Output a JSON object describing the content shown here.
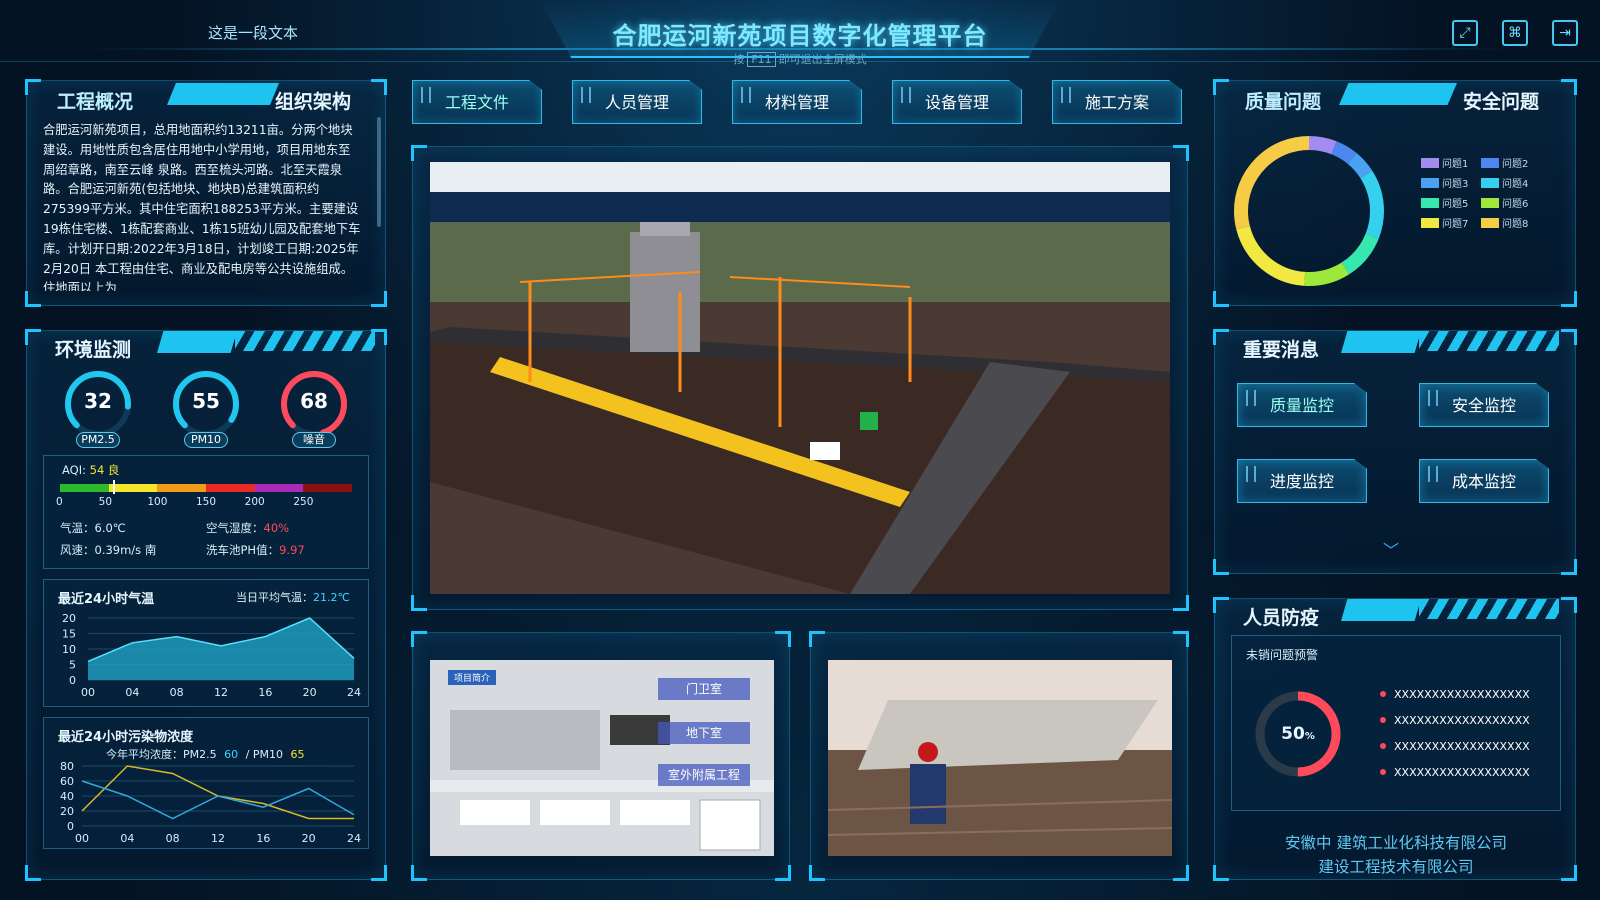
{
  "header": {
    "top_left_text": "这是一段文本",
    "title": "合肥运河新苑项目数字化管理平台",
    "fullscreen_hint_prefix": "按",
    "fullscreen_hint_key": "F11",
    "fullscreen_hint_suffix": "即可退出全屏模式",
    "icons": [
      "fullscreen-icon",
      "apps-icon",
      "logout-icon"
    ]
  },
  "overview": {
    "tab_active": "工程概况",
    "tab_other": "组织架构",
    "text": "合肥运河新苑项目，总用地面积约13211亩。分两个地块建设。用地性质包含居住用地中小学用地，项目用地东至周绍章路，南至云峰 泉路。西至梳头河路。北至天霞泉路。合肥运河新苑(包括地块、地块B)总建筑面积约275399平方米。其中住宅面积188253平方米。主要建设 19栋住宅楼、1栋配套商业、1栋15班幼儿园及配套地下车库。计划开日期:2022年3月18日，计划竣工日期:2025年2月20日 本工程由住宅、商业及配电房等公共设施组成。住地面以上为"
  },
  "environment": {
    "title": "环境监测",
    "gauges": [
      {
        "label": "PM2.5",
        "value": "32",
        "color": "#20c8f0",
        "fraction": 0.35
      },
      {
        "label": "PM10",
        "value": "55",
        "color": "#20c8f0",
        "fraction": 0.45
      },
      {
        "label": "噪音",
        "value": "68",
        "color": "#ff4a5b",
        "fraction": 0.6
      }
    ],
    "aqi_label": "AQI:",
    "aqi_value": "54 良",
    "aqi_fraction": 0.18,
    "aqi_ticks": [
      "0",
      "50",
      "100",
      "150",
      "200",
      "250"
    ],
    "aqi_colors": [
      "#2dbb2d",
      "#f4e52a",
      "#f39b19",
      "#ea2b25",
      "#a72ab8",
      "#8c1212"
    ],
    "temp_label": "气温：",
    "temp_value": "6.0℃",
    "humidity_label": "空气湿度：",
    "humidity_value": "40%",
    "wind_label": "风速：",
    "wind_value": "0.39m/s 南",
    "ph_label": "洗车池PH值：",
    "ph_value": "9.97"
  },
  "temp_chart": {
    "title": "最近24小时气温",
    "avg_label": "当日平均气温：",
    "avg_value": "21.2℃"
  },
  "pollution_chart": {
    "title": "最近24小时污染物浓度",
    "avg_label": "今年平均浓度：PM2.5",
    "pm25_value": "60",
    "sep": "/ PM10",
    "pm10_value": "65"
  },
  "chart_data": [
    {
      "type": "area",
      "title": "最近24小时气温",
      "x": [
        "00",
        "04",
        "08",
        "12",
        "16",
        "20",
        "24"
      ],
      "values": [
        6,
        12,
        14,
        11,
        14,
        20,
        7
      ],
      "ylim": [
        0,
        20
      ],
      "yticks": [
        "0",
        "5",
        "10",
        "15",
        "20"
      ],
      "color": "#1e9bbd"
    },
    {
      "type": "line",
      "title": "最近24小时污染物浓度",
      "x": [
        "00",
        "04",
        "08",
        "12",
        "16",
        "20",
        "24"
      ],
      "yticks": [
        "0",
        "20",
        "40",
        "60",
        "80"
      ],
      "ylim": [
        0,
        80
      ],
      "series": [
        {
          "values": [
            20,
            80,
            70,
            40,
            30,
            10,
            10
          ],
          "color": "#d9b92a"
        },
        {
          "values": [
            60,
            40,
            10,
            40,
            25,
            50,
            15
          ],
          "color": "#2fa9d8"
        }
      ]
    },
    {
      "type": "pie",
      "title": "质量问题",
      "categories": [
        "问题1",
        "问题2",
        "问题3",
        "问题4",
        "问题5",
        "问题6",
        "问题7",
        "问题8"
      ],
      "values": [
        6,
        5,
        5,
        15,
        10,
        10,
        20,
        29
      ],
      "colors": [
        "#a28cf0",
        "#4d86ef",
        "#4aa3f2",
        "#36d0ef",
        "#37e8ae",
        "#9ee83b",
        "#f1e942",
        "#f6cb45"
      ]
    }
  ],
  "tabs": [
    {
      "label": "工程文件"
    },
    {
      "label": "人员管理"
    },
    {
      "label": "材料管理"
    },
    {
      "label": "设备管理"
    },
    {
      "label": "施工方案"
    }
  ],
  "quality": {
    "tab_active": "质量问题",
    "tab_other": "安全问题"
  },
  "messages": {
    "title": "重要消息",
    "buttons": [
      "质量监控",
      "安全监控",
      "进度监控",
      "成本监控"
    ]
  },
  "epidemic": {
    "title": "人员防疫",
    "sub_title": "未销问题预警",
    "percent": "50",
    "percent_suffix": "%",
    "fraction": 0.5,
    "items": [
      "XXXXXXXXXXXXXXXXXX",
      "XXXXXXXXXXXXXXXXXX",
      "XXXXXXXXXXXXXXXXXX",
      "XXXXXXXXXXXXXXXXXX"
    ]
  },
  "camera_1": {
    "badge": "项目简介",
    "labels": [
      "门卫室",
      "地下室",
      "室外附属工程"
    ]
  },
  "footer": {
    "company_1": "安徽中 建筑工业化科技有限公司",
    "company_2": "建设工程技术有限公司"
  }
}
